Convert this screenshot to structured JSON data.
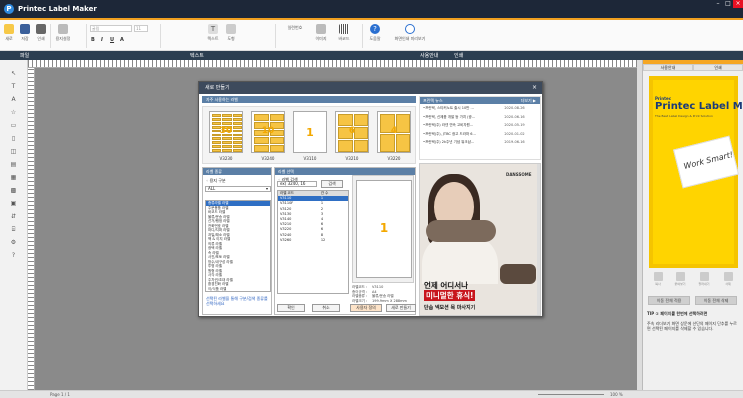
{
  "app": {
    "title": "Printec Label Maker",
    "logo_letter": "P"
  },
  "window_buttons": {
    "min": "–",
    "max": "□",
    "close": "×"
  },
  "ribbon": {
    "new": "새로",
    "save": "저장",
    "print": "인쇄",
    "label_select": "용지설정",
    "font_name": "굴림",
    "font_size": "11",
    "bold": "B",
    "italic": "I",
    "underline": "U",
    "strike": "A",
    "text_btn": "텍스트",
    "shape_btn": "도형",
    "line_btn": "선",
    "serial": "일련번호",
    "image": "이미지",
    "barcode": "바코드",
    "help": "도움말",
    "print_preview": "화면인쇄 미리보기",
    "g_file": "파일",
    "g_text": "텍스트",
    "g_insert": "삽입",
    "g_guide": "사용안내",
    "g_print": "인쇄"
  },
  "menubar": {
    "file": "파일",
    "edit": "텍스트",
    "guide": "사용안내",
    "view": "인쇄"
  },
  "tools": [
    "↖",
    "T",
    "A",
    "☆",
    "▭",
    "▯",
    "◫",
    "▤",
    "▦",
    "▩",
    "▣",
    "⇵",
    "⌸",
    "⚙",
    "?"
  ],
  "statusbar": {
    "page": "Page 1 / 1",
    "zoom": "100 %"
  },
  "right_panel": {
    "tab1": "사용안내",
    "tab2": "인쇄",
    "promo_brand": "Printec",
    "promo_title": "Printec Label Maker",
    "promo_sub": "The Best Label Design & Print Solution",
    "promo_tag": "Work Smart!",
    "icons": [
      "복사",
      "붙여넣기",
      "잘라내기",
      "삭제"
    ],
    "btn_prev": "이동 전체 적용",
    "btn_next": "이동 전체 삭제",
    "tip_title": "TIP ① 페이지를 한번에 선택하려면",
    "tip_body": "주속 리더보기 화면 상운에 산단의 페이지 단추를 누르면 선택된 페이지를 삭제할 수 있습니다."
  },
  "dialog": {
    "title": "새로 만들기",
    "close": "×",
    "recent_header": "자주 사용하는 라벨",
    "thumbs": [
      {
        "label": "V3230",
        "num": "30"
      },
      {
        "label": "V3240",
        "num": "10"
      },
      {
        "label": "V3110",
        "num": "1"
      },
      {
        "label": "V3210",
        "num": "6"
      },
      {
        "label": "V3220",
        "num": "4"
      }
    ],
    "kind_header": "라벨 종류",
    "category_label": "◦ 용지 구분",
    "category_value": "ALL",
    "categories": [
      "종류라벨 라벨",
      "주문용품 라벨",
      "바코드 라벨",
      "물류/운송 라벨",
      "선거/행정 라벨",
      "전화번호 라벨",
      "마디/지퍼 라벨",
      "과일/채소 라벨",
      "책 & 이지 라벨",
      "의류 라벨",
      "광택 라벨",
      "속 라벨",
      "사진/포토 라벨",
      "방수/내구성 라벨",
      "투명 라벨",
      "원형 라벨",
      "사각 라벨",
      "주차권/초대 라벨",
      "환경친화 라벨",
      "이/식품 라벨",
      "미디어 라벨",
      "하이라이트 라벨",
      "진입라벨"
    ],
    "category_note": "선택된 라벨을 통해 구분/검색 종류를 선택하세요",
    "select_header": "라벨 선택",
    "search_label": "◦ 라벨 검색",
    "search_value": "ex) 3240, 16",
    "search_btn": "검색",
    "table_headers": [
      "라벨 코드",
      "칸 수"
    ],
    "table_rows": [
      [
        "V3110",
        "1"
      ],
      [
        "V3110F",
        "1"
      ],
      [
        "V3120",
        "2"
      ],
      [
        "V3130",
        "3"
      ],
      [
        "V3140",
        "4"
      ],
      [
        "V3210",
        "6"
      ],
      [
        "V3220",
        "6"
      ],
      [
        "V3240",
        "8"
      ],
      [
        "V3260",
        "12"
      ]
    ],
    "preview_num": "1",
    "info": [
      {
        "k": "라벨코드 :",
        "v": "V3110"
      },
      {
        "k": "종이규격 :",
        "v": "A4"
      },
      {
        "k": "라벨종류 :",
        "v": "물류/운송 라벨"
      },
      {
        "k": "라벨크기 :",
        "v": "199.9mm X 288mm"
      }
    ],
    "btn_ok": "확인",
    "btn_cancel": "취소",
    "btn_user": "사용자 정의",
    "btn_make": "새로 만들기",
    "news_header": "프린텍 뉴스",
    "news_more": "더보기 ▶",
    "news": [
      {
        "t": "•프린텍, 스티커노트 출시 10만 ...",
        "d": "2020-08-26"
      },
      {
        "t": "•프린텍, 신제품 개발 등 가치 (광...",
        "d": "2020-06-16"
      },
      {
        "t": "•프린텍(주) 라넨 연속 고비자원...",
        "d": "2020-05-19"
      },
      {
        "t": "•프린텍(주), JTBC 광고 드라마 6...",
        "d": "2020-01-02"
      },
      {
        "t": "•프린텍(주) 2k주년 기념 워크샵...",
        "d": "2019-06-16"
      }
    ],
    "ad_logo": "DANSSOME",
    "ad_line1": "언제 어디서나",
    "ad_line2": "미니멀한 휴식!",
    "ad_line3": "단솜 넥모션 목 마사지기"
  },
  "colors": {
    "accent": "#f0a020",
    "titlebar": "#1d2738",
    "dialog_head": "#3d4a5c",
    "section": "#5b7fa6",
    "select": "#2f6fc4"
  }
}
